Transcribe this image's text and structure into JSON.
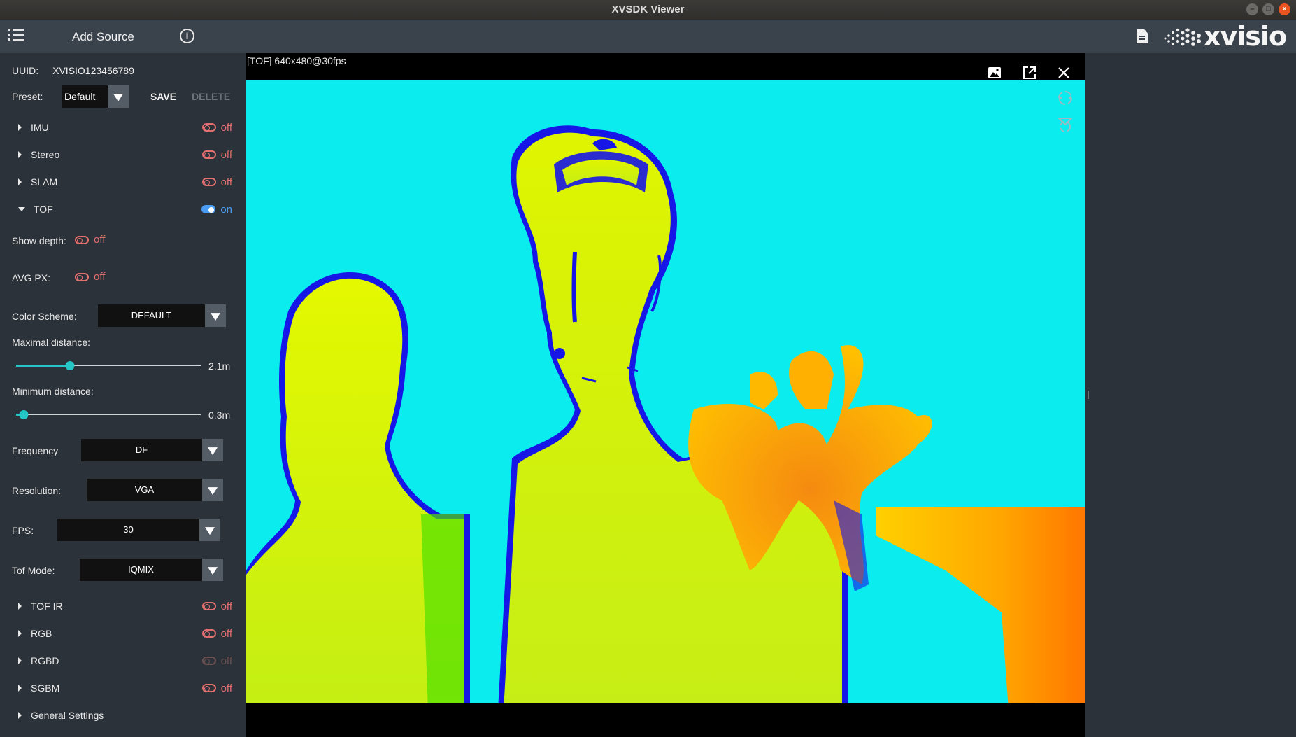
{
  "window": {
    "title": "XVSDK Viewer"
  },
  "topbar": {
    "add_source": "Add Source",
    "logo_text": "xvisio"
  },
  "sidebar": {
    "uuid_label": "UUID:",
    "uuid_value": "XVISIO123456789",
    "preset_label": "Preset:",
    "preset_value": "Default",
    "save": "SAVE",
    "delete": "DELETE",
    "sections": [
      {
        "name": "IMU",
        "state": "off",
        "expanded": false
      },
      {
        "name": "Stereo",
        "state": "off",
        "expanded": false
      },
      {
        "name": "SLAM",
        "state": "off",
        "expanded": false
      },
      {
        "name": "TOF",
        "state": "on",
        "expanded": true
      }
    ],
    "tof": {
      "show_depth_label": "Show depth:",
      "show_depth_state": "off",
      "avg_px_label": "AVG PX:",
      "avg_px_state": "off",
      "color_scheme_label": "Color Scheme:",
      "color_scheme_value": "DEFAULT",
      "max_distance_label": "Maximal distance:",
      "max_distance_value": "2.1m",
      "max_distance_fraction": 0.29,
      "min_distance_label": "Minimum distance:",
      "min_distance_value": "0.3m",
      "min_distance_fraction": 0.04,
      "frequency_label": "Frequency",
      "frequency_value": "DF",
      "resolution_label": "Resolution:",
      "resolution_value": "VGA",
      "fps_label": "FPS:",
      "fps_value": "30",
      "tof_mode_label": "Tof Mode:",
      "tof_mode_value": "IQMIX"
    },
    "sections_bottom": [
      {
        "name": "TOF IR",
        "state": "off"
      },
      {
        "name": "RGB",
        "state": "off"
      },
      {
        "name": "RGBD",
        "state": "off"
      },
      {
        "name": "SGBM",
        "state": "off"
      },
      {
        "name": "General Settings",
        "state": ""
      }
    ]
  },
  "viewer": {
    "title": "[TOF]  640x480@30fps"
  },
  "colors": {
    "accent_on": "#4a9cf5",
    "accent_off": "#e36f6f",
    "slider": "#26c6c6"
  }
}
